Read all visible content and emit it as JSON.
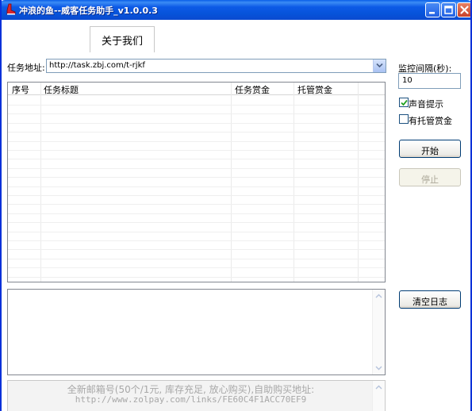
{
  "window": {
    "title": "冲浪的鱼--威客任务助手_v1.0.0.3",
    "title_icon": "boot-icon"
  },
  "tabs": [
    {
      "label": "关于我们"
    }
  ],
  "task_url": {
    "label": "任务地址:",
    "value": "http://task.zbj.com/t-rjkf"
  },
  "task_table": {
    "columns": [
      "序号",
      "任务标题",
      "任务赏金",
      "托管赏金"
    ],
    "rows": []
  },
  "log": {
    "text": ""
  },
  "ad": {
    "line1": "全新邮箱号(50个/1元, 库存充足, 放心购买),自助购买地址:",
    "line2": "http://www.zolpay.com/links/FE60C4F1ACC70EF9"
  },
  "settings": {
    "interval_label": "监控间隔(秒):",
    "interval_value": "10",
    "sound_alert": {
      "label": "声音提示",
      "checked": true
    },
    "escrow_only": {
      "label": "有托管赏金",
      "checked": false
    },
    "start_label": "开始",
    "stop_label": "停止",
    "clear_log_label": "清空日志"
  },
  "colors": {
    "titlebar": "#0a5ee8",
    "window_border": "#0831d9",
    "close_button": "#c8412a"
  }
}
